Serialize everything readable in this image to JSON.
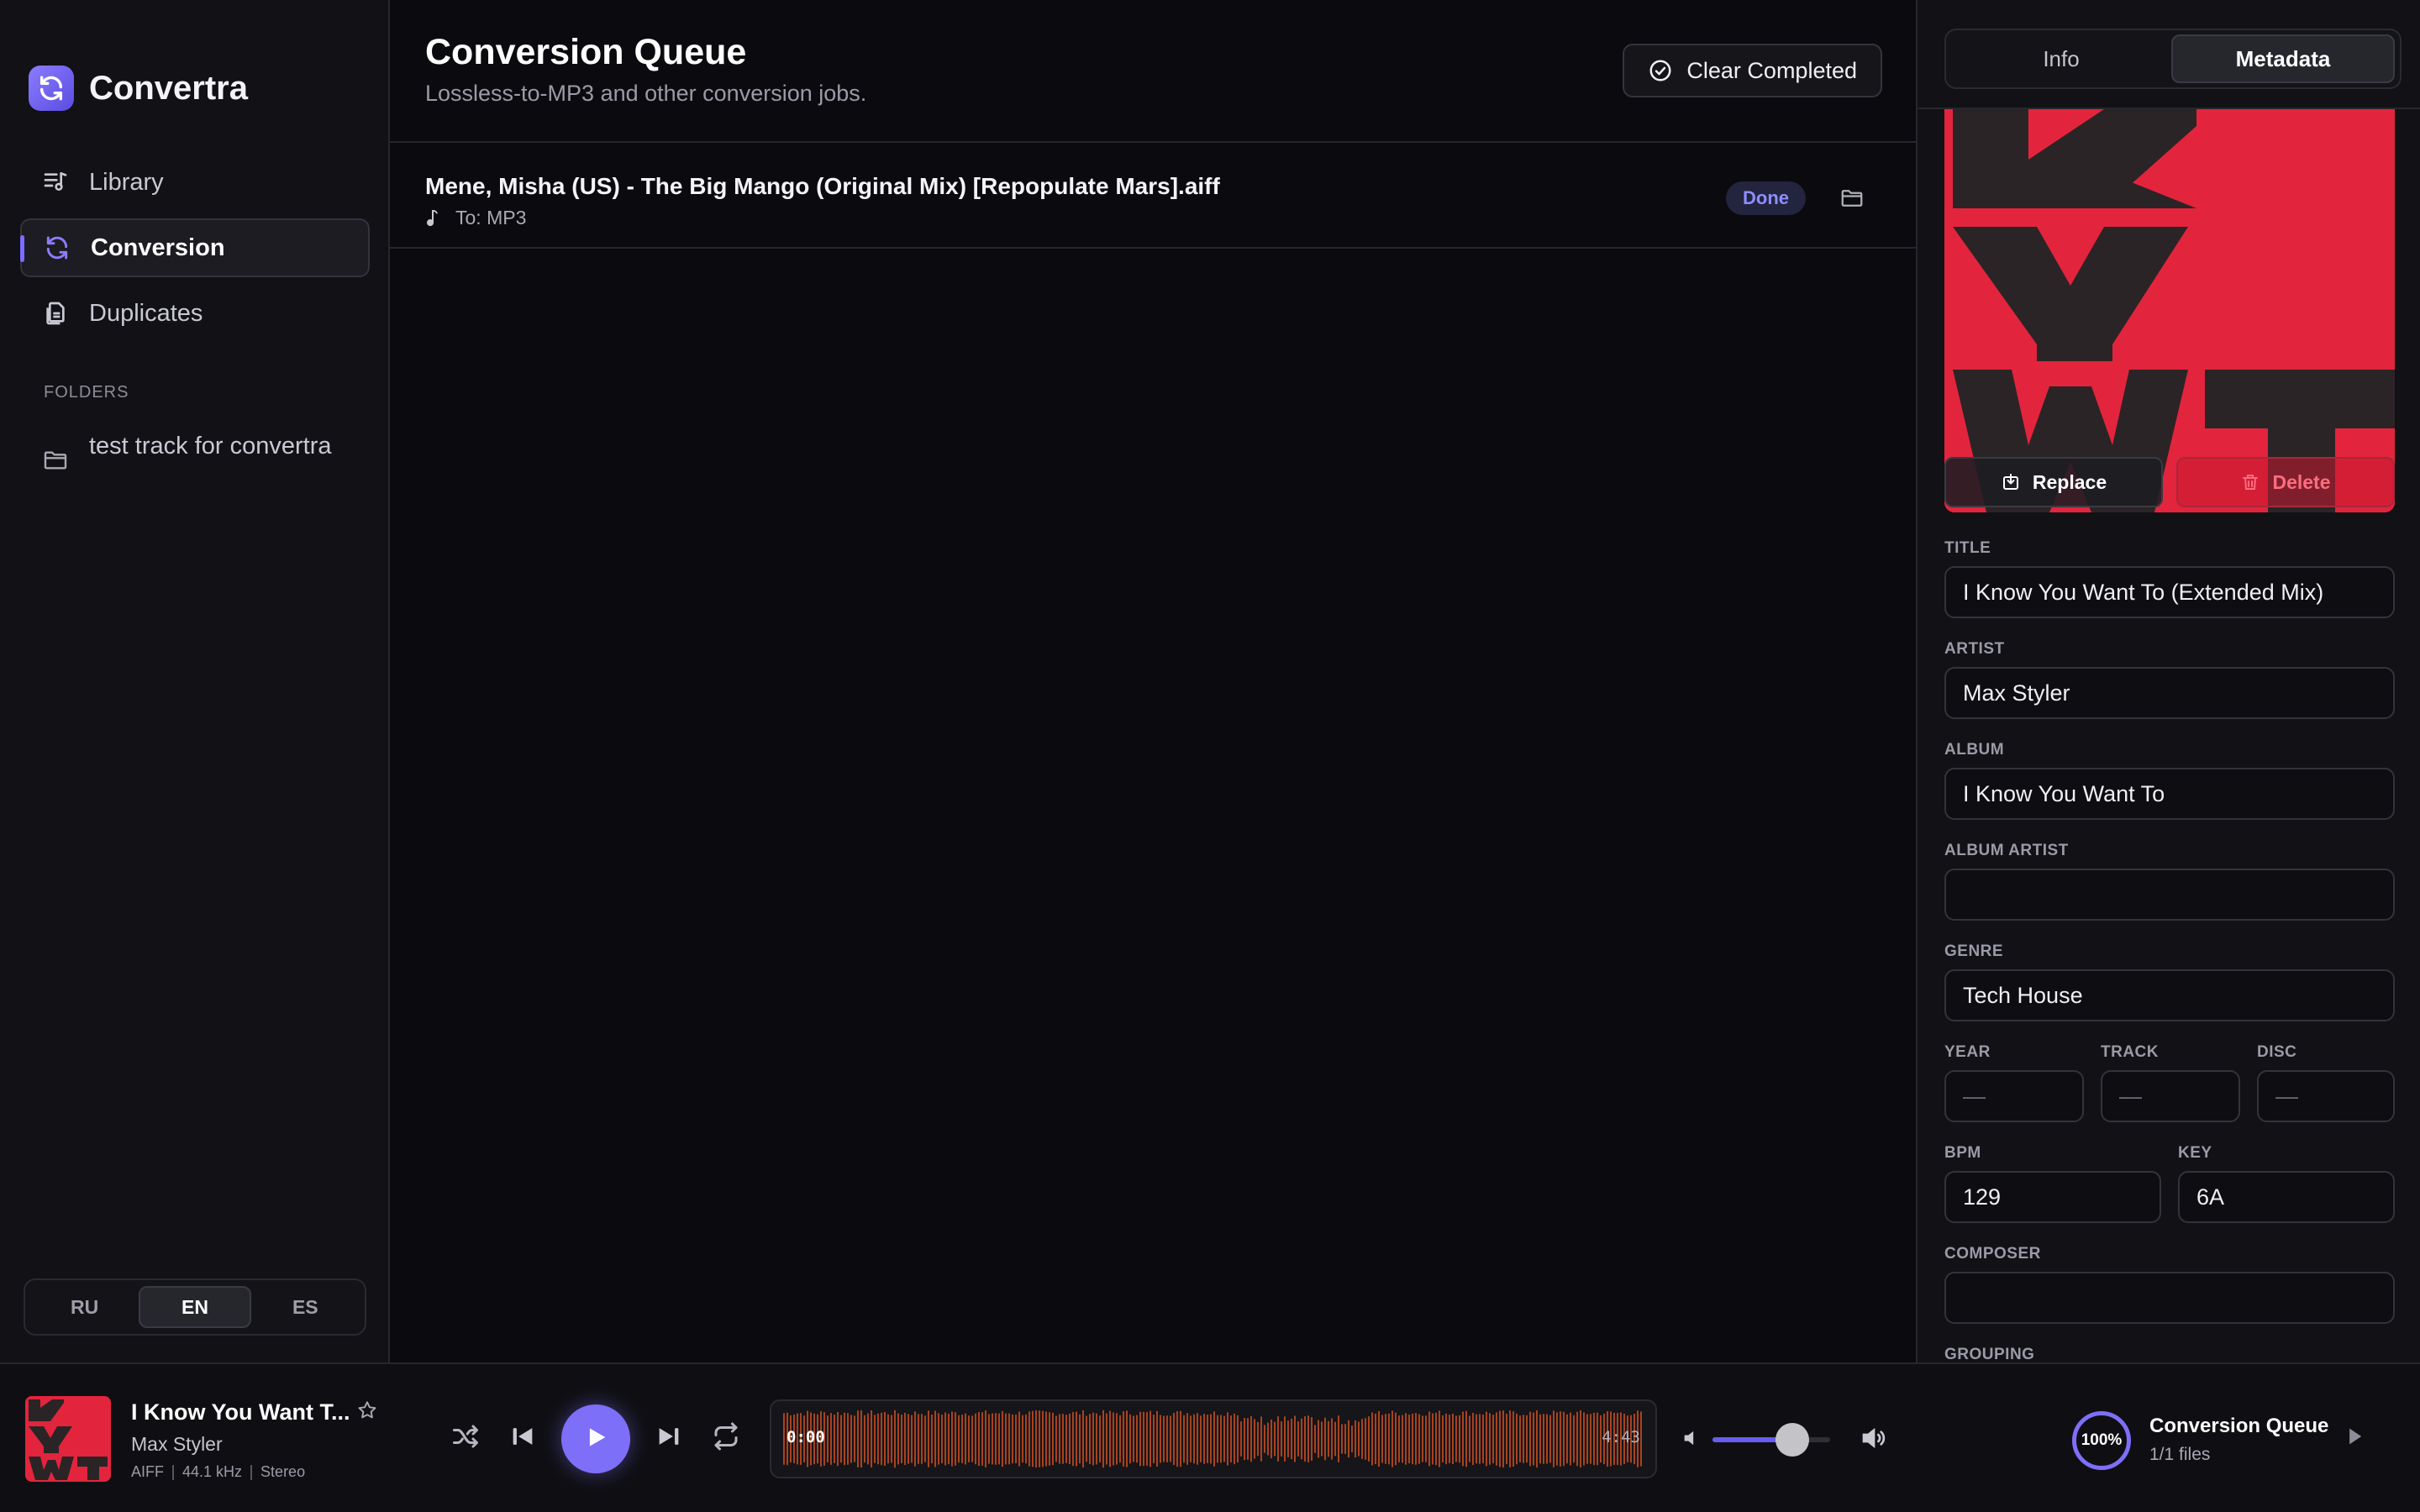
{
  "app": {
    "name": "Convertra"
  },
  "sidebar": {
    "nav": [
      {
        "label": "Library",
        "icon": "music-list-icon"
      },
      {
        "label": "Conversion",
        "icon": "sync-icon"
      },
      {
        "label": "Duplicates",
        "icon": "copy-files-icon"
      }
    ],
    "active_nav": "Conversion",
    "folders_heading": "FOLDERS",
    "folders": [
      {
        "label": "test track for convertra",
        "icon": "folder-icon"
      }
    ],
    "languages": [
      "RU",
      "EN",
      "ES"
    ],
    "active_language": "EN"
  },
  "main": {
    "title": "Conversion Queue",
    "subtitle": "Lossless-to-MP3 and other conversion jobs.",
    "clear_label": "Clear Completed",
    "jobs": [
      {
        "filename": "Mene, Misha (US) - The Big Mango (Original Mix) [Repopulate Mars].aiff",
        "target": "To: MP3",
        "status": "Done"
      }
    ]
  },
  "panel": {
    "tabs": [
      "Info",
      "Metadata"
    ],
    "active_tab": "Metadata",
    "cover": {
      "letters": "KYWT",
      "color": "#e3243d"
    },
    "replace_label": "Replace",
    "delete_label": "Delete",
    "fields": {
      "title": {
        "label": "TITLE",
        "value": "I Know You Want To (Extended Mix)"
      },
      "artist": {
        "label": "ARTIST",
        "value": "Max Styler"
      },
      "album": {
        "label": "ALBUM",
        "value": "I Know You Want To"
      },
      "album_artist": {
        "label": "ALBUM ARTIST",
        "value": ""
      },
      "genre": {
        "label": "GENRE",
        "value": "Tech House"
      },
      "year": {
        "label": "YEAR",
        "placeholder": "—"
      },
      "track": {
        "label": "TRACK",
        "placeholder": "—"
      },
      "disc": {
        "label": "DISC",
        "placeholder": "—"
      },
      "bpm": {
        "label": "BPM",
        "value": "129"
      },
      "key": {
        "label": "KEY",
        "value": "6A"
      },
      "composer": {
        "label": "COMPOSER",
        "value": ""
      },
      "grouping": {
        "label": "GROUPING"
      }
    }
  },
  "player": {
    "title": "I Know You Want T...",
    "artist": "Max Styler",
    "format": "AIFF",
    "sample_rate": "44.1 kHz",
    "channels": "Stereo",
    "current_time": "0:00",
    "total_time": "4:43",
    "volume": 0.68,
    "queue": {
      "percent": "100%",
      "title": "Conversion Queue",
      "subtitle": "1/1 files"
    }
  },
  "colors": {
    "accent": "#7d6ff8",
    "waveform": "#a8431e",
    "cover": "#e3243d",
    "done_badge": "#8e8dff"
  }
}
